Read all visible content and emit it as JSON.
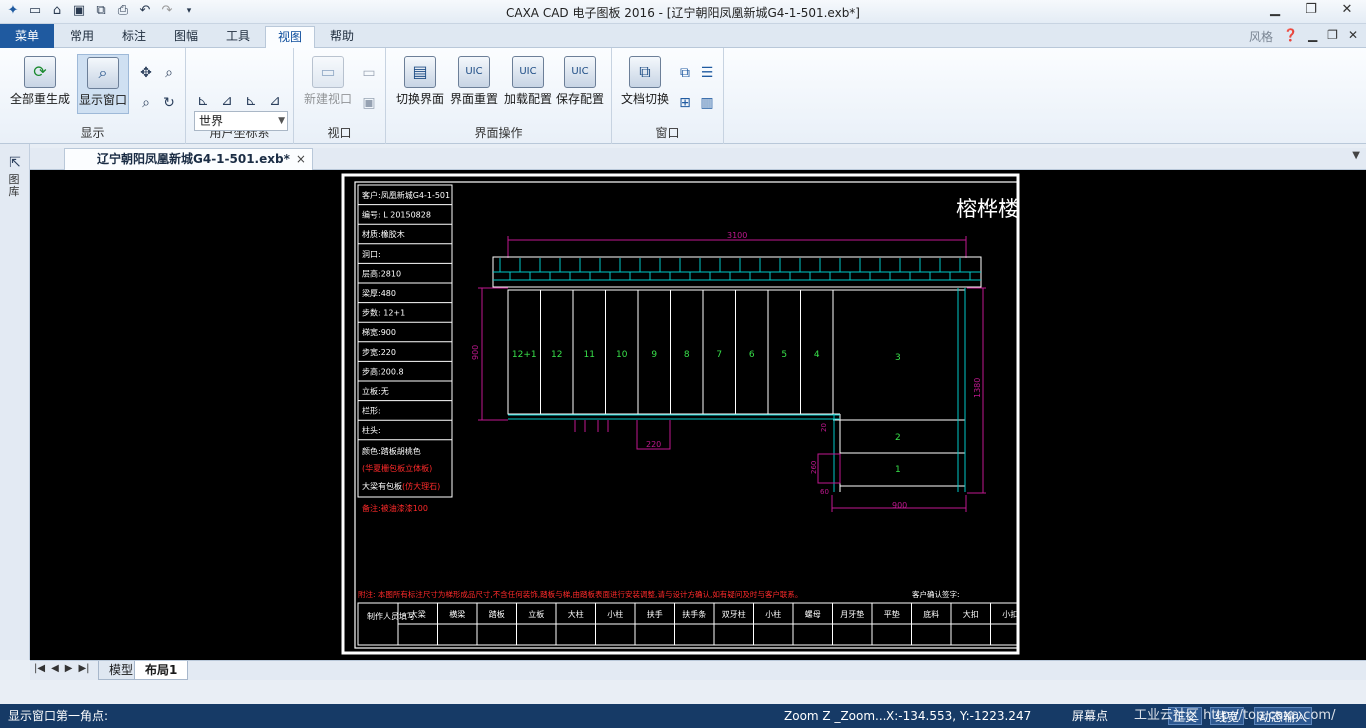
{
  "titlebar": {
    "title": "CAXA CAD 电子图板 2016 - [辽宁朝阳凤凰新城G4-1-501.exb*]",
    "qat_icons": [
      "app-icon",
      "new-icon",
      "open-icon",
      "save-icon",
      "save-as-icon",
      "print-icon",
      "undo-icon",
      "redo-icon"
    ]
  },
  "tabs": {
    "menu": "菜单",
    "items": [
      "常用",
      "标注",
      "图幅",
      "工具",
      "视图",
      "帮助"
    ],
    "active": "视图",
    "style_label": "风格"
  },
  "ribbon": {
    "display": {
      "label": "显示",
      "regen_all": "全部重生成",
      "display_window": "显示窗口"
    },
    "ucs": {
      "label": "用户坐标系",
      "combo_value": "世界"
    },
    "viewport": {
      "label": "视口",
      "new_viewport": "新建视口"
    },
    "ui_ops": {
      "label": "界面操作",
      "switch_ui": "切换界面",
      "reset_ui": "界面重置",
      "load_config": "加载配置",
      "save_config": "保存配置"
    },
    "window": {
      "label": "窗口",
      "doc_switch": "文档切换"
    }
  },
  "sidebar": {
    "label": "图库"
  },
  "document": {
    "tab": "辽宁朝阳凤凰新城G4-1-501.exb*",
    "close": "×"
  },
  "drawing": {
    "company_title": "榕桦楼",
    "info_rows": [
      "客户:凤凰新城G4-1-501",
      "编号: L 20150828",
      "材质:橡胶木",
      "洞口:",
      "层高:2810",
      "梁厚:480",
      "步数: 12+1",
      "梯宽:900",
      "步宽:220",
      "步高:200.8",
      "立板:无",
      "栏形:",
      "柱头:"
    ],
    "color_line": "颜色:踏板胡桃色",
    "red_line1": "(华夏栅包板立体板)",
    "big_board": "大梁有包板",
    "big_board_red": "(仿大理石)",
    "remark": "备注:被油漆漆100",
    "dim_top": "3100",
    "dim_left": "900",
    "dim_right": "1380",
    "dim_bottom": "900",
    "dim_step": "220",
    "dim_small_a": "260",
    "dim_small_b": "20",
    "dim_small_c": "60",
    "steps_row": [
      "12+1",
      "12",
      "11",
      "10",
      "9",
      "8",
      "7",
      "6",
      "5",
      "4"
    ],
    "landing": [
      "3",
      "2",
      "1"
    ],
    "notes": "附注: 本图所有标注尺寸为梯形成品尺寸,不含任何装饰,踏板与梯,由踏板表面进行安装调整,请与设计方确认,如有疑问及时与客户联系。",
    "client_confirm": "客户确认签字:",
    "table_header_label": "制作人员填写",
    "table_columns": [
      "大梁",
      "横梁",
      "踏板",
      "立板",
      "大柱",
      "小柱",
      "扶手",
      "扶手条",
      "双牙柱",
      "小柱",
      "螺母",
      "月牙垫",
      "平垫",
      "底料",
      "大扣",
      "小扣"
    ]
  },
  "sheettabs": {
    "model": "模型",
    "layout": "布局1"
  },
  "statusbar": {
    "prompt": "显示窗口第一角点:",
    "zoom": "Zoom Z _Zoom...",
    "coords": "X:-134.553, Y:-1223.247",
    "screen_point": "屏幕点",
    "ortho": "正交",
    "linewidth": "线宽",
    "dynamic": "动态输入",
    "watermark": "工业云社区 http://top.caxa.com/"
  }
}
